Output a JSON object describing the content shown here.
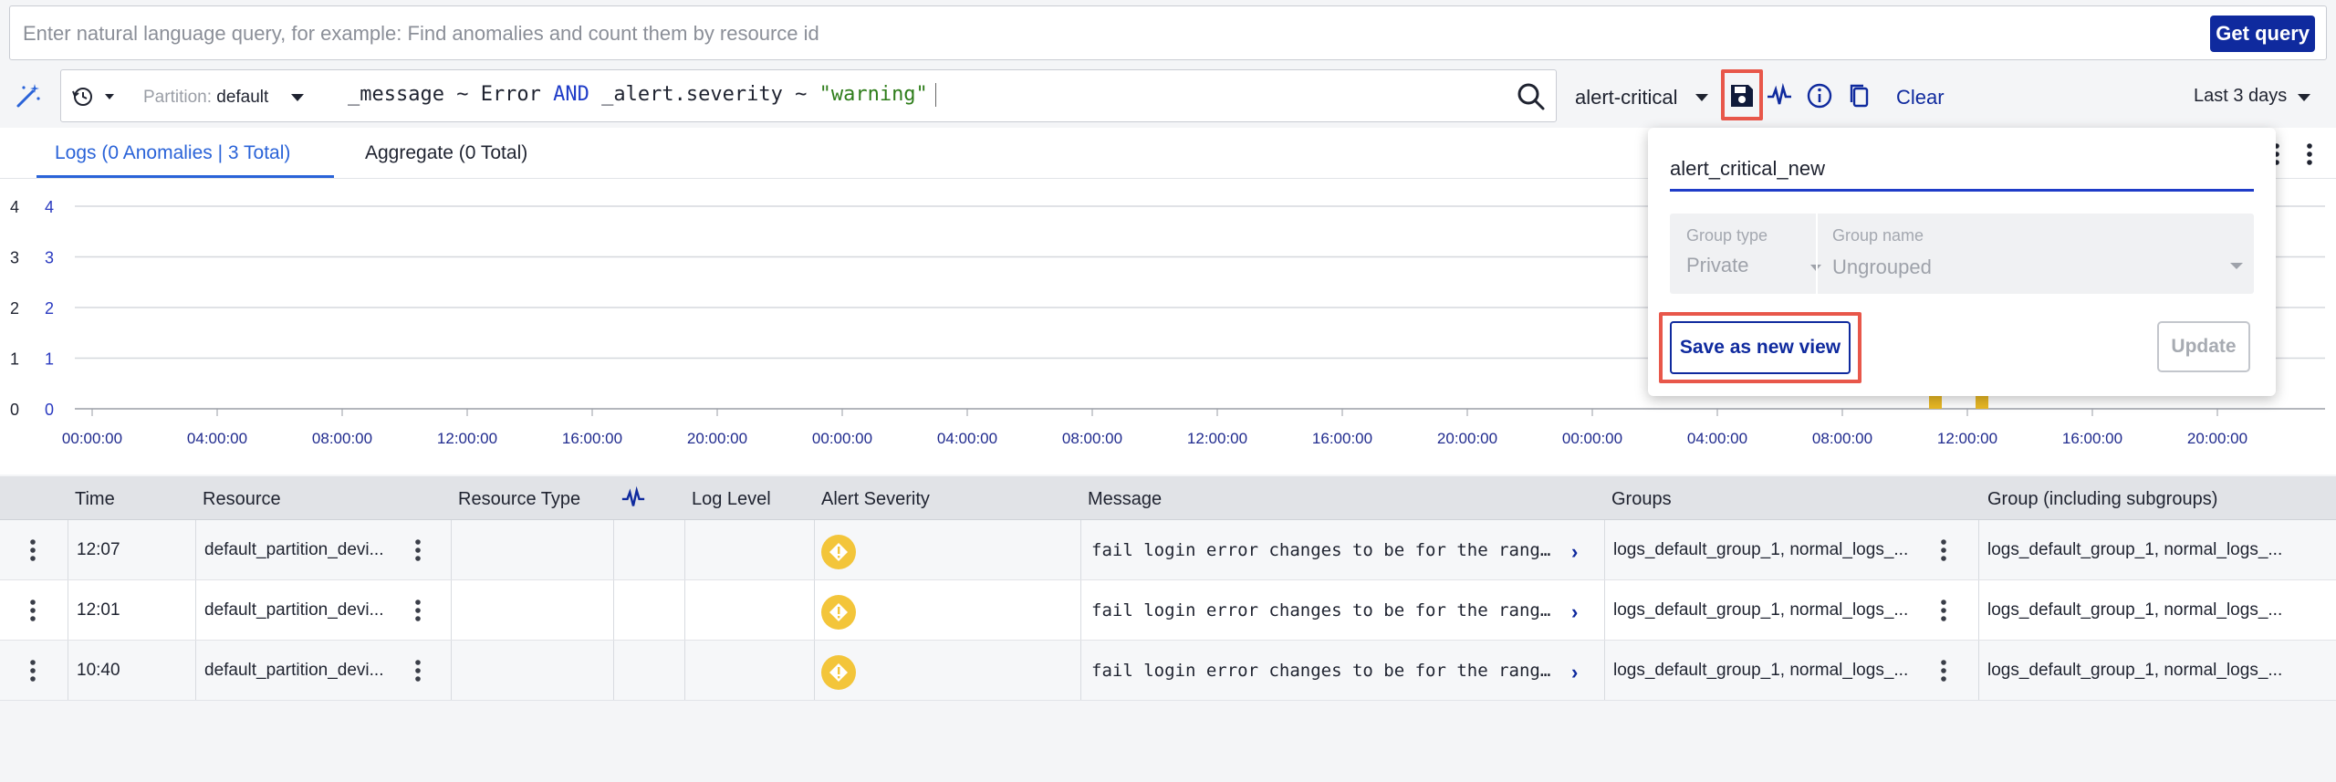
{
  "nl_query": {
    "placeholder": "Enter natural language query, for example: Find anomalies and count them by resource id",
    "button_label": "Get query"
  },
  "toolbar": {
    "partition_label": "Partition:",
    "partition_value": "default",
    "query_parts": {
      "p1": "_message ~ Error ",
      "kw": "AND",
      "p2": " _alert.severity ~ ",
      "str": "\"warning\""
    },
    "view_name": "alert-critical",
    "clear_label": "Clear",
    "time_range": "Last 3 days"
  },
  "tabs": {
    "logs": "Logs (0 Anomalies | 3 Total)",
    "aggregate": "Aggregate (0 Total)"
  },
  "chart_data": {
    "type": "bar",
    "y_ticks_left": [
      "4",
      "3",
      "2",
      "1",
      "0"
    ],
    "y_ticks_right": [
      "4",
      "3",
      "2",
      "1",
      "0"
    ],
    "ylim": [
      0,
      4
    ],
    "x_ticks": [
      "00:00:00",
      "04:00:00",
      "08:00:00",
      "12:00:00",
      "16:00:00",
      "20:00:00",
      "00:00:00",
      "04:00:00",
      "08:00:00",
      "12:00:00",
      "16:00:00",
      "20:00:00",
      "00:00:00",
      "04:00:00",
      "08:00:00",
      "12:00:00",
      "16:00:00",
      "20:00:00"
    ],
    "bar_color": "#e8b825"
  },
  "table": {
    "headers": [
      "Time",
      "Resource",
      "Resource Type",
      "",
      "Log Level",
      "Alert Severity",
      "Message",
      "Groups",
      "Group (including subgroups)"
    ],
    "rows": [
      {
        "time": "12:07",
        "resource": "default_partition_devi...",
        "message": "fail login error changes to be for the range...",
        "groups": "logs_default_group_1, normal_logs_...",
        "subgroups": "logs_default_group_1, normal_logs_..."
      },
      {
        "time": "12:01",
        "resource": "default_partition_devi...",
        "message": "fail login error changes to be for the range...",
        "groups": "logs_default_group_1, normal_logs_...",
        "subgroups": "logs_default_group_1, normal_logs_..."
      },
      {
        "time": "10:40",
        "resource": "default_partition_devi...",
        "message": "fail login error changes to be for the range...",
        "groups": "logs_default_group_1, normal_logs_...",
        "subgroups": "logs_default_group_1, normal_logs_..."
      }
    ]
  },
  "save_popup": {
    "view_name_value": "alert_critical_new",
    "group_type_label": "Group type",
    "group_type_value": "Private",
    "group_name_label": "Group name",
    "group_name_value": "Ungrouped",
    "save_new_label": "Save as new view",
    "update_label": "Update"
  },
  "colors": {
    "brand": "#0f2a9e",
    "accent": "#2a63d8",
    "highlight": "#e8574a",
    "warning": "#f3c53a"
  }
}
